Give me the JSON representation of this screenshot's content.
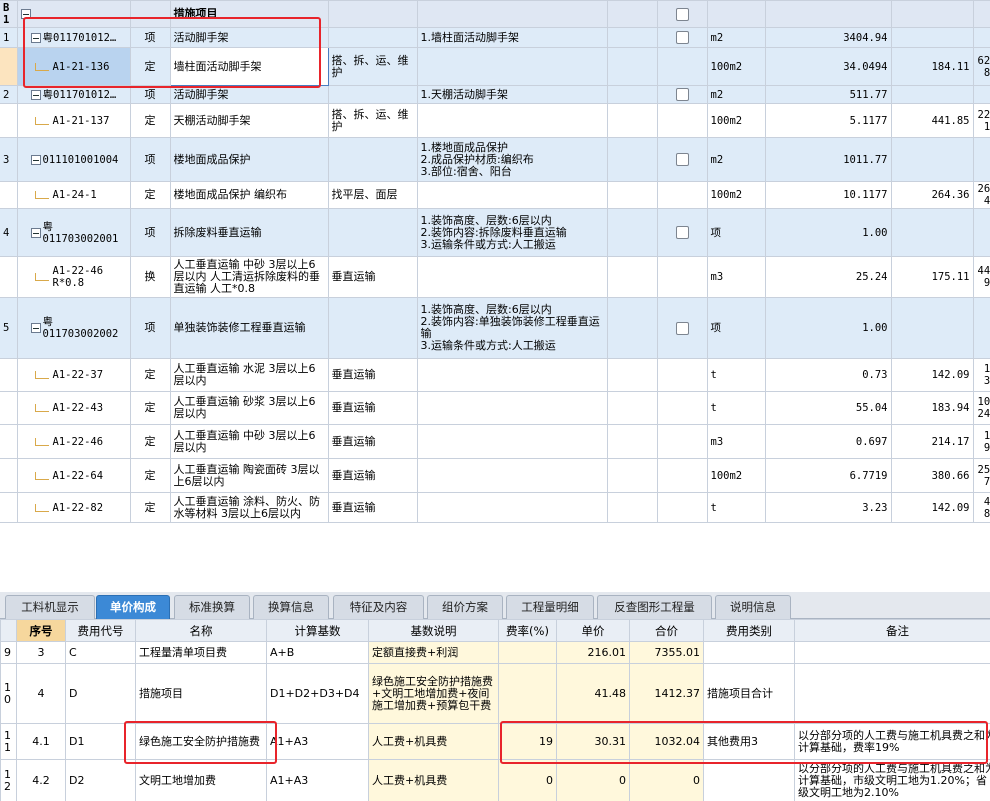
{
  "grid": {
    "header_idx": "B1",
    "header_label": "措施项目",
    "rows": [
      {
        "kind": "q",
        "idx": "1",
        "code": "粤011701012…",
        "type": "项",
        "name": "活动脚手架",
        "feat": "",
        "desc": "1.墙柱面活动脚手架",
        "unit": "m2",
        "qty": "3404.94",
        "price": "",
        "total": ""
      },
      {
        "kind": "sel",
        "idx": "",
        "code": "A1-21-136",
        "type": "定",
        "name": "墙柱面活动脚手架",
        "feat": "搭、拆、运、维护",
        "desc": "",
        "unit": "100m2",
        "qty": "34.0494",
        "price": "184.11",
        "total": "6268."
      },
      {
        "kind": "q",
        "idx": "2",
        "code": "粤011701012…",
        "type": "项",
        "name": "活动脚手架",
        "feat": "",
        "desc": "1.天棚活动脚手架",
        "unit": "m2",
        "qty": "511.77",
        "price": "",
        "total": ""
      },
      {
        "kind": "d",
        "idx": "",
        "code": "A1-21-137",
        "type": "定",
        "name": "天棚活动脚手架",
        "feat": "搭、拆、运、维护",
        "desc": "",
        "unit": "100m2",
        "qty": "5.1177",
        "price": "441.85",
        "total": "2261."
      },
      {
        "kind": "q",
        "idx": "3",
        "code": "011101001004",
        "type": "项",
        "name": "楼地面成品保护",
        "feat": "",
        "desc": "1.楼地面成品保护\n2.成品保护材质:编织布\n3.部位:宿舍、阳台",
        "unit": "m2",
        "qty": "1011.77",
        "price": "",
        "total": ""
      },
      {
        "kind": "d",
        "idx": "",
        "code": "A1-24-1",
        "type": "定",
        "name": "楼地面成品保护 编织布",
        "feat": "找平层、面层",
        "desc": "",
        "unit": "100m2",
        "qty": "10.1177",
        "price": "264.36",
        "total": "2674."
      },
      {
        "kind": "q",
        "idx": "4",
        "code": "粤\n011703002001",
        "type": "项",
        "name": "拆除废料垂直运输",
        "feat": "",
        "desc": "1.装饰高度、层数:6层以内\n2.装饰内容:拆除废料垂直运输\n3.运输条件或方式:人工搬运",
        "unit": "项",
        "qty": "1.00",
        "price": "",
        "total": ""
      },
      {
        "kind": "d",
        "idx": "",
        "code": "A1-22-46\nR*0.8",
        "type": "换",
        "name": "人工垂直运输 中砂 3层以上6层以内  人工清运拆除废料的垂直运输 人工*0.8",
        "feat": "垂直运输",
        "desc": "",
        "unit": "m3",
        "qty": "25.24",
        "price": "175.11",
        "total": "4419."
      },
      {
        "kind": "q",
        "idx": "5",
        "code": "粤\n011703002002",
        "type": "项",
        "name": "单独装饰装修工程垂直运输",
        "feat": "",
        "desc": "1.装饰高度、层数:6层以内\n2.装饰内容:单独装饰装修工程垂直运输\n3.运输条件或方式:人工搬运",
        "unit": "项",
        "qty": "1.00",
        "price": "",
        "total": ""
      },
      {
        "kind": "d",
        "idx": "",
        "code": "A1-22-37",
        "type": "定",
        "name": "人工垂直运输 水泥 3层以上6层以内",
        "feat": "垂直运输",
        "desc": "",
        "unit": "t",
        "qty": "0.73",
        "price": "142.09",
        "total": "103."
      },
      {
        "kind": "d",
        "idx": "",
        "code": "A1-22-43",
        "type": "定",
        "name": "人工垂直运输 砂浆 3层以上6层以内",
        "feat": "垂直运输",
        "desc": "",
        "unit": "t",
        "qty": "55.04",
        "price": "183.94",
        "total": "10124."
      },
      {
        "kind": "d",
        "idx": "",
        "code": "A1-22-46",
        "type": "定",
        "name": "人工垂直运输 中砂 3层以上6层以内",
        "feat": "垂直运输",
        "desc": "",
        "unit": "m3",
        "qty": "0.697",
        "price": "214.17",
        "total": "149."
      },
      {
        "kind": "d",
        "idx": "",
        "code": "A1-22-64",
        "type": "定",
        "name": "人工垂直运输 陶瓷面砖 3层以上6层以内",
        "feat": "垂直运输",
        "desc": "",
        "unit": "100m2",
        "qty": "6.7719",
        "price": "380.66",
        "total": "2577."
      },
      {
        "kind": "d",
        "idx": "",
        "code": "A1-22-82",
        "type": "定",
        "name": "人工垂直运输 涂料、防火、防水等材料 3层以上6层以内",
        "feat": "垂直运输",
        "desc": "",
        "unit": "t",
        "qty": "3.23",
        "price": "142.09",
        "total": "458."
      }
    ]
  },
  "tabs": [
    "工料机显示",
    "单价构成",
    "标准换算",
    "换算信息",
    "特征及内容",
    "组价方案",
    "工程量明细",
    "反查图形工程量",
    "说明信息"
  ],
  "active_tab": 1,
  "bottom": {
    "headers": [
      "序号",
      "费用代号",
      "名称",
      "计算基数",
      "基数说明",
      "费率(%)",
      "单价",
      "合价",
      "费用类别",
      "备注"
    ],
    "rows": [
      {
        "rn": "9",
        "seq": "3",
        "code": "C",
        "name": "工程量清单项目费",
        "base": "A+B",
        "basedesc": "定额直接费+利润",
        "rate": "",
        "price": "216.01",
        "total": "7355.01",
        "cat": "",
        "note": ""
      },
      {
        "rn": "10",
        "seq": "4",
        "code": "D",
        "name": "措施项目",
        "base": "D1+D2+D3+D4",
        "basedesc": "绿色施工安全防护措施费+文明工地增加费+夜间施工增加费+预算包干费",
        "rate": "",
        "price": "41.48",
        "total": "1412.37",
        "cat": "措施项目合计",
        "note": ""
      },
      {
        "rn": "11",
        "seq": "4.1",
        "code": "D1",
        "name": "绿色施工安全防护措施费",
        "base": "A1+A3",
        "basedesc": "人工费+机具费",
        "rate": "19",
        "price": "30.31",
        "total": "1032.04",
        "cat": "其他费用3",
        "note": "以分部分项的人工费与施工机具费之和为计算基础，费率19%"
      },
      {
        "rn": "12",
        "seq": "4.2",
        "code": "D2",
        "name": "文明工地增加费",
        "base": "A1+A3",
        "basedesc": "人工费+机具费",
        "rate": "0",
        "price": "0",
        "total": "0",
        "cat": "",
        "note": "以分部分项的人工费与施工机具费之和为计算基础，市级文明工地为1.20%；省级文明工地为2.10%"
      }
    ]
  }
}
